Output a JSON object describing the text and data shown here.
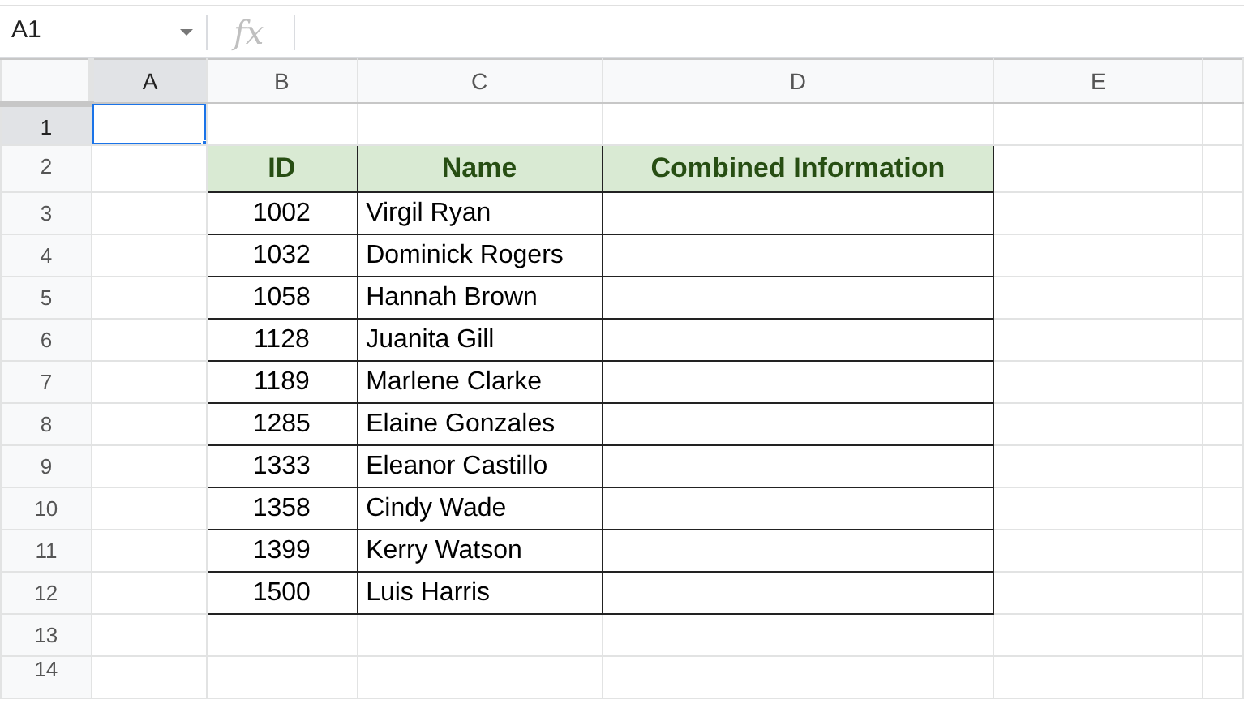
{
  "name_box": {
    "value": "A1"
  },
  "formula_bar": {
    "fx_label": "fx"
  },
  "columns": [
    {
      "label": "A",
      "selected": true
    },
    {
      "label": "B",
      "selected": false
    },
    {
      "label": "C",
      "selected": false
    },
    {
      "label": "D",
      "selected": false
    },
    {
      "label": "E",
      "selected": false
    }
  ],
  "rows": [
    {
      "label": "1",
      "selected": true,
      "kind": "blank"
    },
    {
      "label": "2",
      "selected": false,
      "kind": "header",
      "cells": [
        "ID",
        "Name",
        "Combined Information"
      ]
    },
    {
      "label": "3",
      "selected": false,
      "kind": "data",
      "cells": [
        "1002",
        "Virgil Ryan"
      ]
    },
    {
      "label": "4",
      "selected": false,
      "kind": "data",
      "cells": [
        "1032",
        "Dominick Rogers"
      ]
    },
    {
      "label": "5",
      "selected": false,
      "kind": "data",
      "cells": [
        "1058",
        "Hannah Brown"
      ]
    },
    {
      "label": "6",
      "selected": false,
      "kind": "data",
      "cells": [
        "1128",
        "Juanita Gill"
      ]
    },
    {
      "label": "7",
      "selected": false,
      "kind": "data",
      "cells": [
        "1189",
        "Marlene Clarke"
      ]
    },
    {
      "label": "8",
      "selected": false,
      "kind": "data",
      "cells": [
        "1285",
        "Elaine Gonzales"
      ]
    },
    {
      "label": "9",
      "selected": false,
      "kind": "data",
      "cells": [
        "1333",
        "Eleanor Castillo"
      ]
    },
    {
      "label": "10",
      "selected": false,
      "kind": "data",
      "cells": [
        "1358",
        "Cindy Wade"
      ]
    },
    {
      "label": "11",
      "selected": false,
      "kind": "data",
      "cells": [
        "1399",
        "Kerry Watson"
      ]
    },
    {
      "label": "12",
      "selected": false,
      "kind": "data",
      "cells": [
        "1500",
        "Luis Harris"
      ]
    },
    {
      "label": "13",
      "selected": false,
      "kind": "blank"
    },
    {
      "label": "14",
      "selected": false,
      "kind": "blank"
    }
  ]
}
